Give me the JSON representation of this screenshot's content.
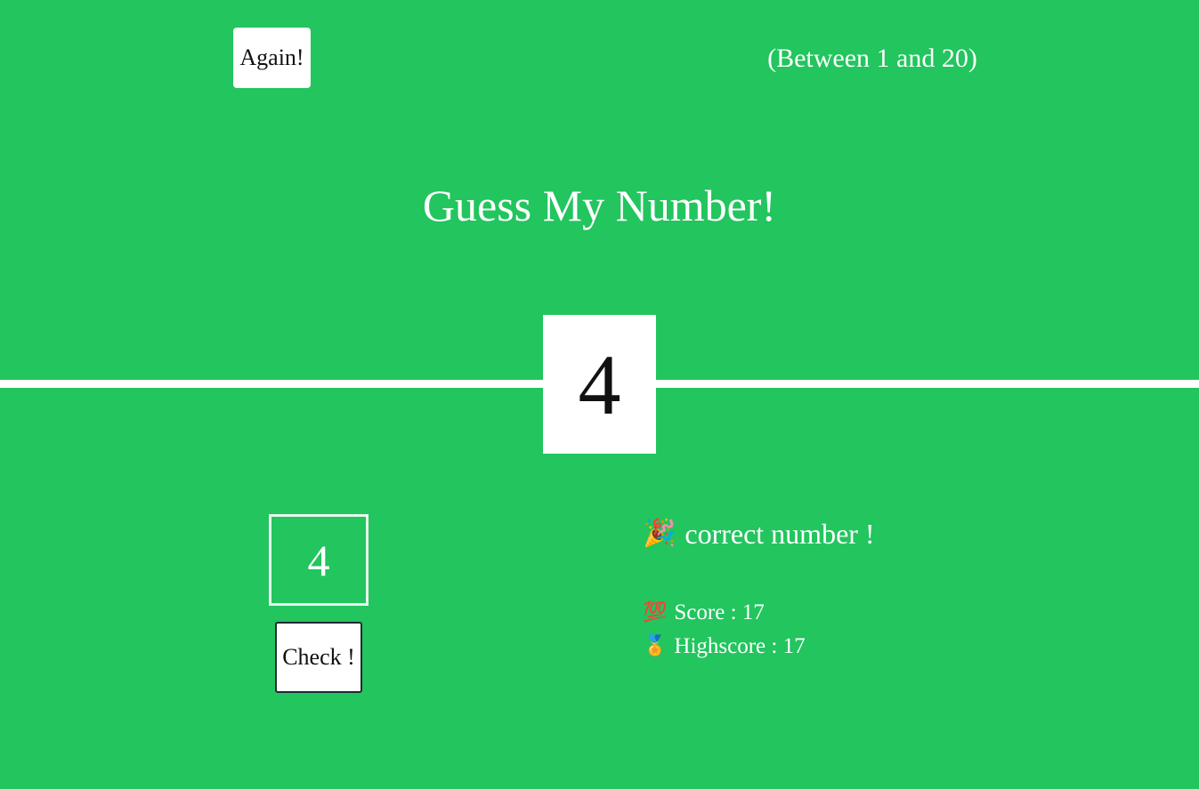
{
  "header": {
    "again_label": "Again!",
    "range_text": "(Between 1 and 20)"
  },
  "title": "Guess My Number!",
  "secret_number": "4",
  "guess": {
    "value": "4",
    "check_label": "Check !"
  },
  "message": {
    "icon": "party-popper-icon",
    "emoji": "🎉",
    "text": "correct number !"
  },
  "stats": {
    "score_icon": "hundred-points-icon",
    "score_emoji": "💯",
    "score_label": "Score :",
    "score_value": "17",
    "highscore_icon": "medal-icon",
    "highscore_emoji": "🏅",
    "highscore_label": "Highscore :",
    "highscore_value": "17"
  },
  "colors": {
    "background": "#22c55e",
    "text": "#ffffff",
    "box": "#ffffff"
  }
}
